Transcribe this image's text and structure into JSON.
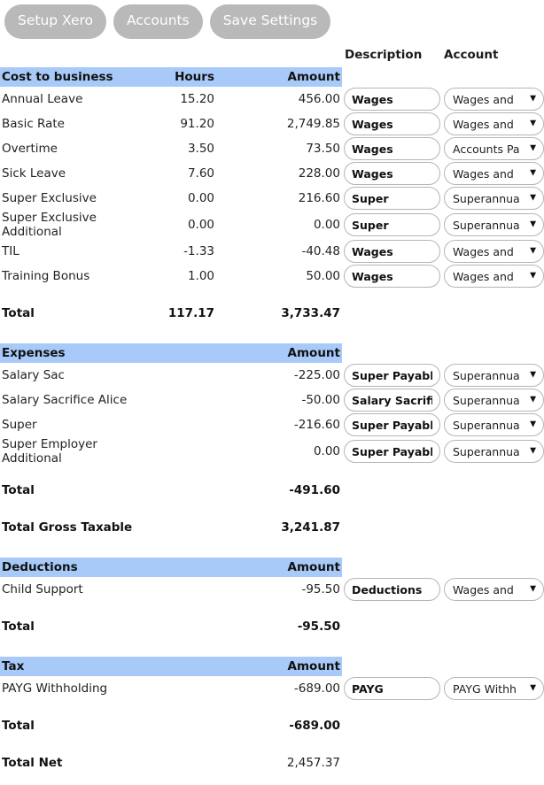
{
  "toolbar": {
    "buttons": [
      {
        "label": "Setup Xero",
        "name": "setup-xero-button"
      },
      {
        "label": "Accounts",
        "name": "accounts-button"
      },
      {
        "label": "Save Settings",
        "name": "save-settings-button"
      }
    ]
  },
  "column_headers": {
    "description": "Description",
    "account": "Account"
  },
  "colors": {
    "band": "#a8caf9",
    "button": "#b9b9b9",
    "button_text": "#ffffff",
    "text": "#232323"
  },
  "sections": [
    {
      "name": "cost-to-business",
      "band": {
        "label": "Cost to business",
        "hours": "Hours",
        "amount": "Amount"
      },
      "rows": [
        {
          "label": "Annual Leave",
          "hours": "15.20",
          "amount": "456.00",
          "description": "Wages",
          "account": "Wages and"
        },
        {
          "label": "Basic Rate",
          "hours": "91.20",
          "amount": "2,749.85",
          "description": "Wages",
          "account": "Wages and"
        },
        {
          "label": "Overtime",
          "hours": "3.50",
          "amount": "73.50",
          "description": "Wages",
          "account": "Accounts Pa"
        },
        {
          "label": "Sick Leave",
          "hours": "7.60",
          "amount": "228.00",
          "description": "Wages",
          "account": "Wages and"
        },
        {
          "label": "Super Exclusive",
          "hours": "0.00",
          "amount": "216.60",
          "description": "Super",
          "account": "Superannua"
        },
        {
          "label": "Super Exclusive Additional",
          "hours": "0.00",
          "amount": "0.00",
          "description": "Super",
          "account": "Superannua"
        },
        {
          "label": "TIL",
          "hours": "-1.33",
          "amount": "-40.48",
          "description": "Wages",
          "account": "Wages and"
        },
        {
          "label": "Training Bonus",
          "hours": "1.00",
          "amount": "50.00",
          "description": "Wages",
          "account": "Wages and"
        }
      ],
      "total": {
        "label": "Total",
        "hours": "117.17",
        "amount": "3,733.47"
      }
    },
    {
      "name": "expenses",
      "band": {
        "label": "Expenses",
        "hours": "",
        "amount": "Amount"
      },
      "rows": [
        {
          "label": "Salary Sac",
          "hours": "",
          "amount": "-225.00",
          "description": "Super Payable",
          "account": "Superannua"
        },
        {
          "label": "Salary Sacrifice Alice",
          "hours": "",
          "amount": "-50.00",
          "description": "Salary Sacrifice",
          "account": "Superannua"
        },
        {
          "label": "Super",
          "hours": "",
          "amount": "-216.60",
          "description": "Super Payable",
          "account": "Superannua"
        },
        {
          "label": "Super Employer Additional",
          "hours": "",
          "amount": "0.00",
          "description": "Super Payable",
          "account": "Superannua"
        }
      ],
      "total": {
        "label": "Total",
        "hours": "",
        "amount": "-491.60"
      },
      "extra_total": {
        "label": "Total Gross Taxable",
        "hours": "",
        "amount": "3,241.87"
      }
    },
    {
      "name": "deductions",
      "band": {
        "label": "Deductions",
        "hours": "",
        "amount": "Amount"
      },
      "rows": [
        {
          "label": "Child Support",
          "hours": "",
          "amount": "-95.50",
          "description": "Deductions",
          "account": "Wages and"
        }
      ],
      "total": {
        "label": "Total",
        "hours": "",
        "amount": "-95.50"
      }
    },
    {
      "name": "tax",
      "band": {
        "label": "Tax",
        "hours": "",
        "amount": "Amount"
      },
      "rows": [
        {
          "label": "PAYG Withholding",
          "hours": "",
          "amount": "-689.00",
          "description": "PAYG",
          "account": "PAYG Withh"
        }
      ],
      "total": {
        "label": "Total",
        "hours": "",
        "amount": "-689.00"
      },
      "extra_total": {
        "label": "Total Net",
        "hours": "",
        "amount": "2,457.37",
        "value_plain": true
      }
    }
  ],
  "icons": {
    "dropdown_arrow": "▼"
  }
}
